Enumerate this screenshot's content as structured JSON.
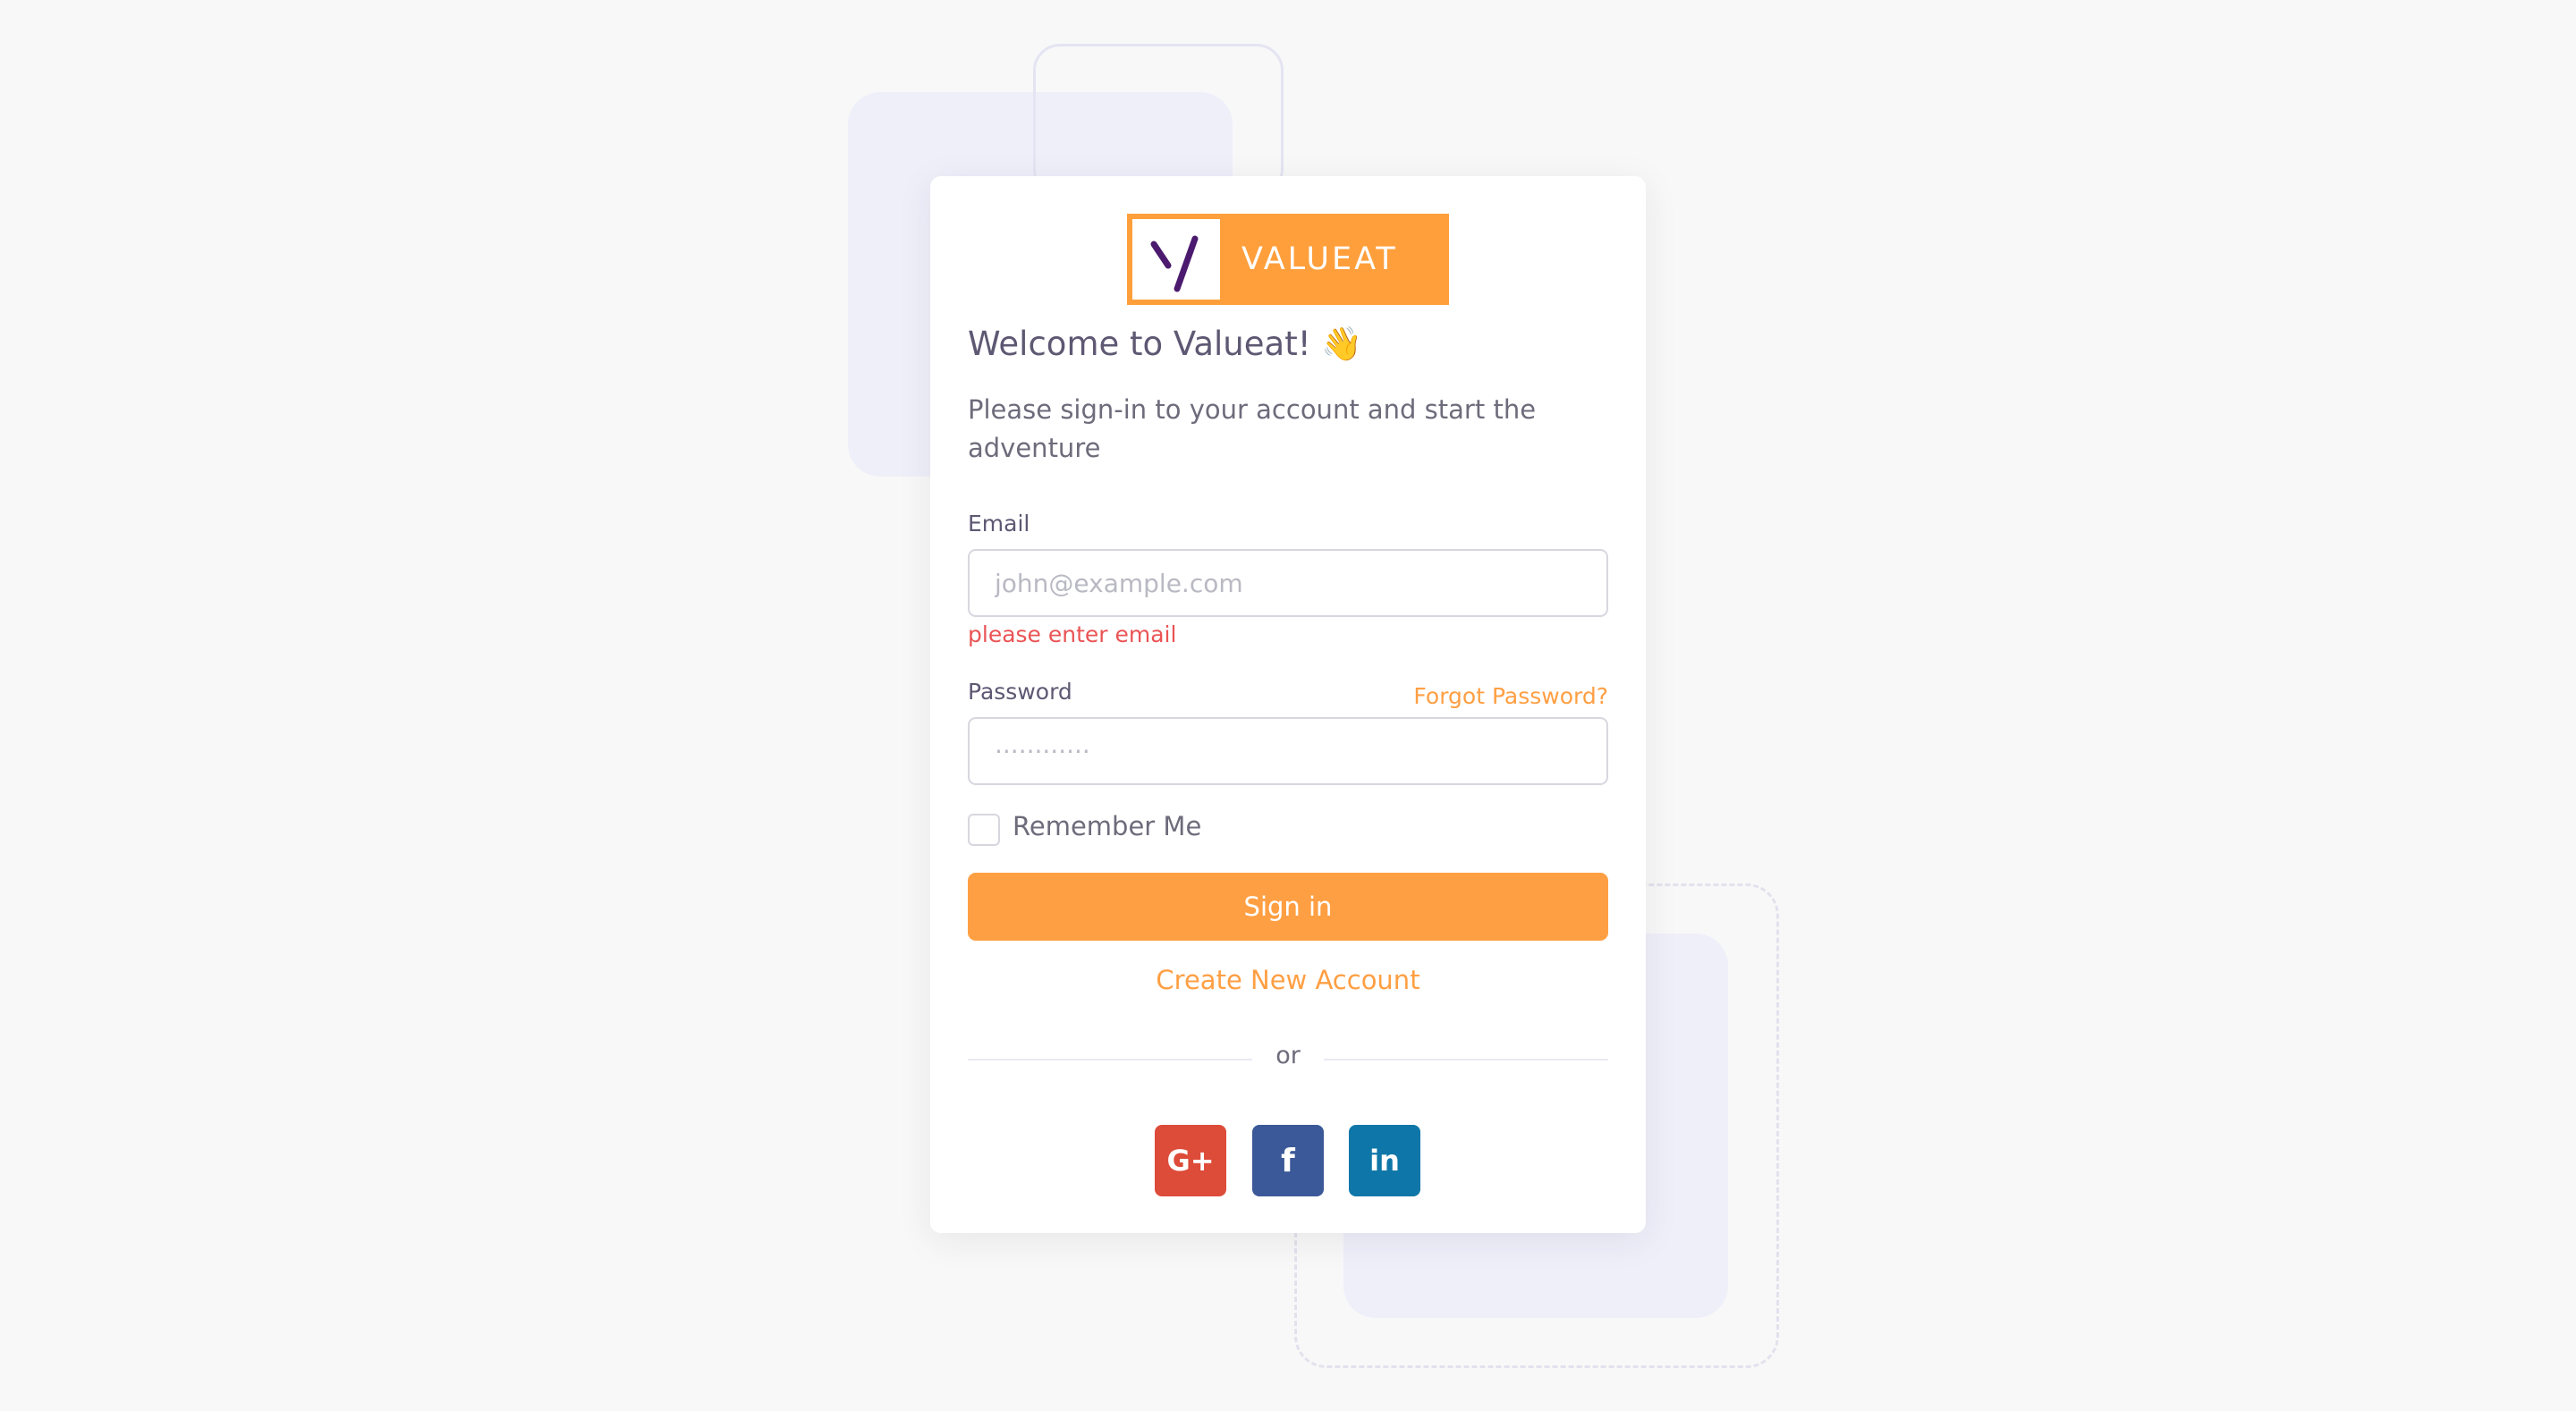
{
  "brand": {
    "name": "VALUEAT",
    "accent_color": "#ff9f43",
    "mark_color": "#4b1a6e"
  },
  "login": {
    "title": "Welcome to Valueat! 👋",
    "subtitle": "Please sign-in to your account and start the adventure",
    "email": {
      "label": "Email",
      "placeholder": "john@example.com",
      "value": "",
      "error": "please enter email"
    },
    "password": {
      "label": "Password",
      "placeholder": "············",
      "value": "",
      "forgot_label": "Forgot Password?"
    },
    "remember_label": "Remember Me",
    "remember_checked": false,
    "signin_label": "Sign in",
    "create_account_label": "Create New Account",
    "divider_label": "or"
  },
  "social": [
    {
      "name": "google-plus",
      "glyph": "G+",
      "color": "#dd4b39"
    },
    {
      "name": "facebook",
      "glyph": "f",
      "color": "#3b5998"
    },
    {
      "name": "linkedin",
      "glyph": "in",
      "color": "#0e76a8"
    }
  ]
}
